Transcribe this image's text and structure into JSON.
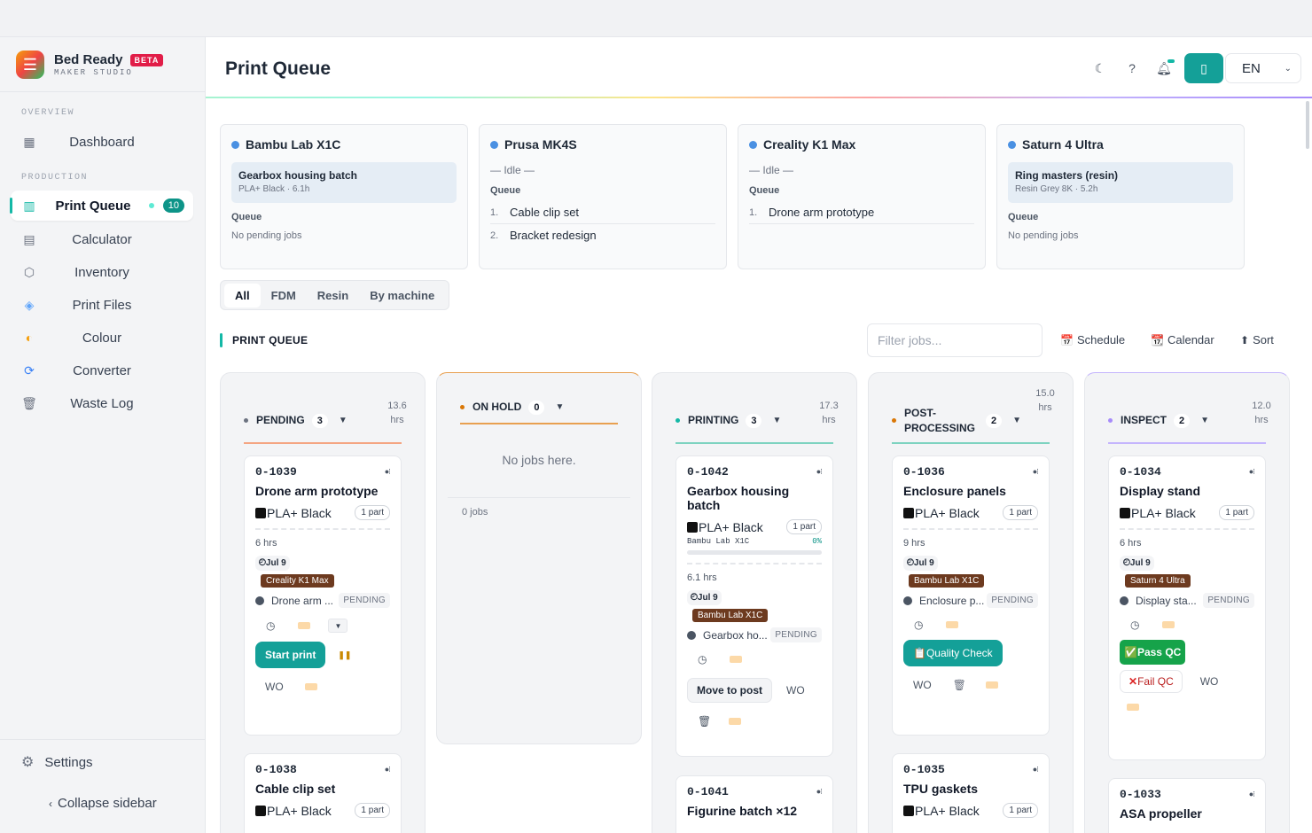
{
  "brand": {
    "name": "Bed Ready",
    "badge": "BETA",
    "subtitle": "MAKER STUDIO",
    "logo_icon": "menu-icon"
  },
  "sidebar": {
    "sections": [
      {
        "label": "OVERVIEW"
      },
      {
        "label": "PRODUCTION"
      }
    ],
    "items": [
      {
        "label": "Dashboard",
        "icon": "grid-icon"
      },
      {
        "label": "Print Queue",
        "icon": "queue-icon",
        "count": "10"
      },
      {
        "label": "Calculator",
        "icon": "calculator-icon"
      },
      {
        "label": "Inventory",
        "icon": "box-icon"
      },
      {
        "label": "Print Files",
        "icon": "cube-icon"
      },
      {
        "label": "Colour",
        "icon": "palette-icon"
      },
      {
        "label": "Converter",
        "icon": "convert-icon"
      },
      {
        "label": "Waste Log",
        "icon": "trash-icon"
      }
    ],
    "settings": "Settings",
    "collapse": "Collapse sidebar"
  },
  "header": {
    "title": "Print Queue",
    "lang": "EN"
  },
  "machines": [
    {
      "name": "Bambu Lab X1C",
      "current": {
        "title": "Gearbox housing batch",
        "sub": "PLA+ Black · 6.1h"
      },
      "queue_label": "Queue",
      "queue_none": "No pending jobs"
    },
    {
      "name": "Prusa MK4S",
      "idle": "— Idle —",
      "queue_label": "Queue",
      "queue": [
        "Cable clip set",
        "Bracket redesign"
      ]
    },
    {
      "name": "Creality K1 Max",
      "idle": "— Idle —",
      "queue_label": "Queue",
      "queue": [
        "Drone arm prototype"
      ]
    },
    {
      "name": "Saturn 4 Ultra",
      "current": {
        "title": "Ring masters (resin)",
        "sub": "Resin Grey 8K · 5.2h"
      },
      "queue_label": "Queue",
      "queue_none": "No pending jobs"
    }
  ],
  "filters": {
    "tabs": [
      "All",
      "FDM",
      "Resin",
      "By machine"
    ],
    "active": "All"
  },
  "section_title": "PRINT QUEUE",
  "search": {
    "placeholder": "Filter jobs..."
  },
  "toolbar": {
    "schedule": "Schedule",
    "calendar": "Calendar",
    "sort": "Sort"
  },
  "columns": [
    {
      "title": "PENDING",
      "count": "3",
      "hrs": "13.6",
      "unit": "hrs",
      "color": "#f4a582",
      "dot": "#6b7280"
    },
    {
      "title": "ON HOLD",
      "count": "0",
      "color": "#e8a050",
      "dot": "#d97706",
      "empty": "No jobs here.",
      "jobs_count": "0 jobs"
    },
    {
      "title": "PRINTING",
      "count": "3",
      "hrs": "17.3",
      "unit": "hrs",
      "color": "#7dd3c0",
      "dot": "#14b8a6"
    },
    {
      "title": "POST-",
      "title2": "PROCESSING",
      "count": "2",
      "hrs": "15.0",
      "unit": "hrs",
      "color": "#7dd3c0",
      "dot": "#d97706"
    },
    {
      "title": "INSPECT",
      "count": "2",
      "hrs": "12.0",
      "unit": "hrs",
      "color": "#c4b5fd",
      "dot": "#a78bfa"
    }
  ],
  "cards": {
    "c1039": {
      "id": "0-1039",
      "title": "Drone arm prototype",
      "material": "PLA+ Black",
      "parts": "1 part",
      "hrs": "6 hrs",
      "date": "Jul 9",
      "machine": "Creality K1 Max",
      "status_name": "Drone arm ...",
      "status": "PENDING",
      "action": "Start print",
      "wo": "WO"
    },
    "c1038": {
      "id": "0-1038",
      "title": "Cable clip set",
      "material": "PLA+ Black",
      "parts": "1 part"
    },
    "c1042": {
      "id": "0-1042",
      "title": "Gearbox housing batch",
      "material": "PLA+ Black",
      "parts": "1 part",
      "printer": "Bambu Lab X1C",
      "progress": "0%",
      "hrs": "6.1 hrs",
      "date": "Jul 9",
      "machine": "Bambu Lab X1C",
      "status_name": "Gearbox ho...",
      "status": "PENDING",
      "action": "Move to post",
      "wo": "WO"
    },
    "c1041": {
      "id": "0-1041",
      "title": "Figurine batch ×12"
    },
    "c1036": {
      "id": "0-1036",
      "title": "Enclosure panels",
      "material": "PLA+ Black",
      "parts": "1 part",
      "hrs": "9 hrs",
      "date": "Jul 9",
      "machine": "Bambu Lab X1C",
      "status_name": "Enclosure p...",
      "status": "PENDING",
      "action": "Quality Check",
      "wo": "WO"
    },
    "c1035": {
      "id": "0-1035",
      "title": "TPU gaskets",
      "material": "PLA+ Black",
      "parts": "1 part"
    },
    "c1034": {
      "id": "0-1034",
      "title": "Display stand",
      "material": "PLA+ Black",
      "parts": "1 part",
      "hrs": "6 hrs",
      "date": "Jul 9",
      "machine": "Saturn 4 Ultra",
      "status_name": "Display sta...",
      "status": "PENDING",
      "pass": "Pass QC",
      "fail": "Fail QC",
      "wo": "WO"
    },
    "c1033": {
      "id": "0-1033",
      "title": "ASA propeller"
    }
  }
}
